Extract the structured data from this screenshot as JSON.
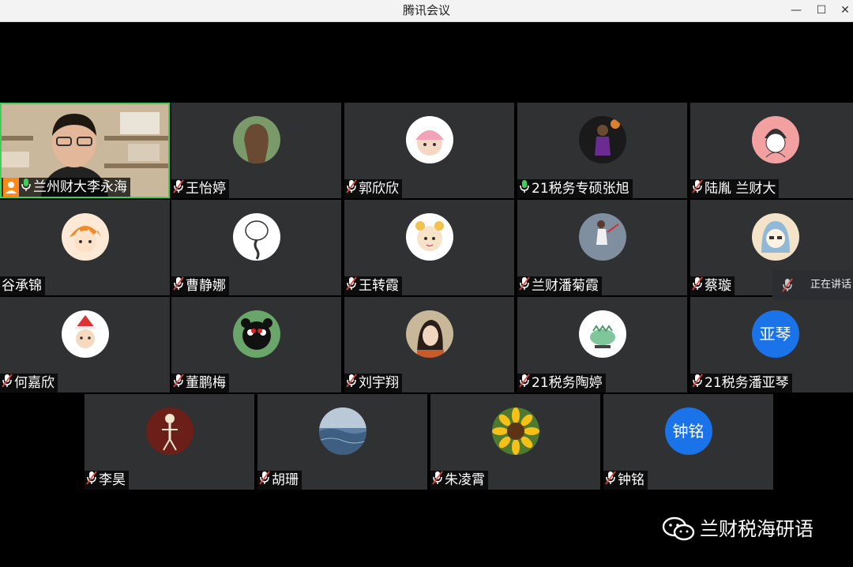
{
  "window": {
    "title": "腾讯会议",
    "controls": [
      "minimize-icon",
      "maximize-icon",
      "close-icon"
    ]
  },
  "participants": [
    {
      "name": "兰州财大李永海",
      "mic": "on",
      "avatar": "camera-video",
      "host": true
    },
    {
      "name": "王怡婷",
      "mic": "muted",
      "avatar": "illustrated-girl-avatar"
    },
    {
      "name": "郭欣欣",
      "mic": "muted",
      "avatar": "cartoon-girl-avatar"
    },
    {
      "name": "21税务专硕张旭",
      "mic": "on",
      "avatar": "basketball-player-avatar"
    },
    {
      "name": "陆胤 兰财大",
      "mic": "muted",
      "avatar": "hat-sketch-avatar"
    },
    {
      "name": "谷承锦",
      "mic": "none",
      "avatar": "orange-hair-cartoon-avatar"
    },
    {
      "name": "曹静娜",
      "mic": "muted",
      "avatar": "braid-sketch-avatar"
    },
    {
      "name": "王转霞",
      "mic": "muted",
      "avatar": "cartoon-animal-avatar"
    },
    {
      "name": "兰财潘菊霞",
      "mic": "muted",
      "avatar": "tennis-player-avatar"
    },
    {
      "name": "蔡璇",
      "mic": "muted",
      "avatar": "hooded-cartoon-avatar"
    },
    {
      "name": "何嘉欣",
      "mic": "muted",
      "avatar": "santa-hat-cartoon-avatar"
    },
    {
      "name": "董鹏梅",
      "mic": "muted",
      "avatar": "kumamon-avatar"
    },
    {
      "name": "刘宇翔",
      "mic": "muted",
      "avatar": "portrait-photo-avatar"
    },
    {
      "name": "21税务陶婷",
      "mic": "muted",
      "avatar": "dinosaur-avatar"
    },
    {
      "name": "21税务潘亚琴",
      "mic": "muted",
      "avatar": "text",
      "avatar_text": "亚琴"
    },
    {
      "name": "李昊",
      "mic": "muted",
      "avatar": "skeleton-avatar"
    },
    {
      "name": "胡珊",
      "mic": "muted",
      "avatar": "sea-avatar"
    },
    {
      "name": "朱凌霄",
      "mic": "muted",
      "avatar": "sunflower-avatar"
    },
    {
      "name": "钟铭",
      "mic": "muted",
      "avatar": "text",
      "avatar_text": "钟铭"
    }
  ],
  "speaking_indicator": {
    "text": "正在讲话"
  },
  "watermark": {
    "text": "兰财税海研语"
  },
  "colors": {
    "tile": "#2f3133",
    "active_border": "#3fcf5a",
    "text_avatar": "#1a73e8",
    "muted_mic": "#e0443e",
    "on_mic": "#3fcf5a",
    "host_badge": "#ff8a1a"
  }
}
